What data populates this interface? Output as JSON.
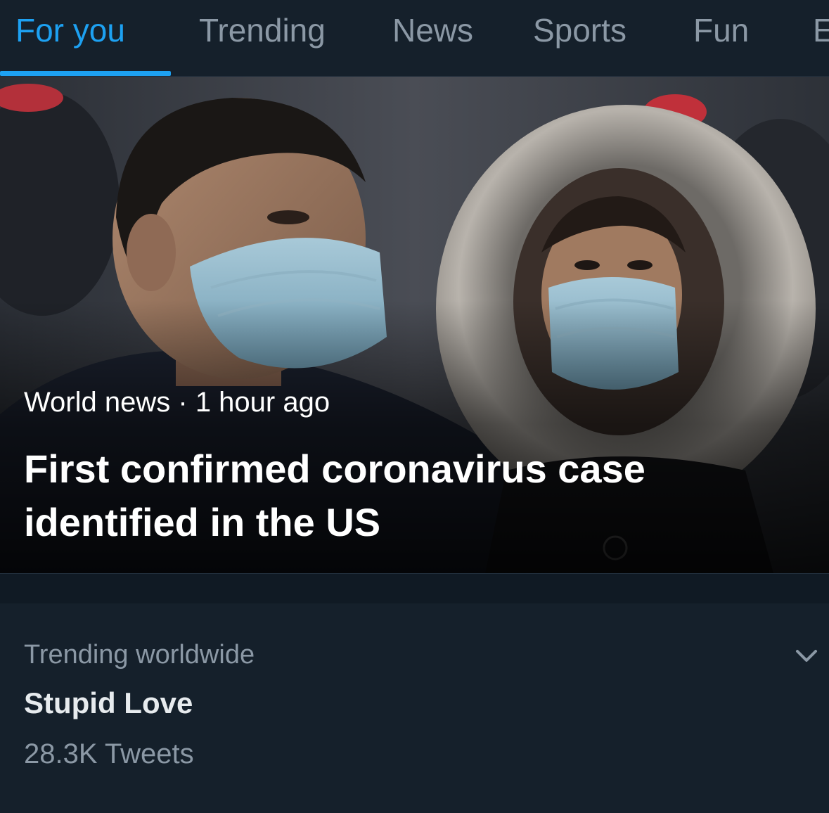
{
  "tabs": [
    {
      "label": "For you",
      "active": true
    },
    {
      "label": "Trending",
      "active": false
    },
    {
      "label": "News",
      "active": false
    },
    {
      "label": "Sports",
      "active": false
    },
    {
      "label": "Fun",
      "active": false
    },
    {
      "label": "E",
      "active": false
    }
  ],
  "hero": {
    "category": "World news",
    "separator": "·",
    "time": "1 hour ago",
    "title_line1": "First confirmed coronavirus case",
    "title_line2": "identified in the US"
  },
  "trend": {
    "context": "Trending worldwide",
    "name": "Stupid Love",
    "count": "28.3K Tweets",
    "more_icon": "chevron-down-icon"
  },
  "colors": {
    "background": "#15202b",
    "accent": "#1da1f2",
    "secondary_text": "#8b98a5",
    "primary_text": "#e7ebee"
  }
}
